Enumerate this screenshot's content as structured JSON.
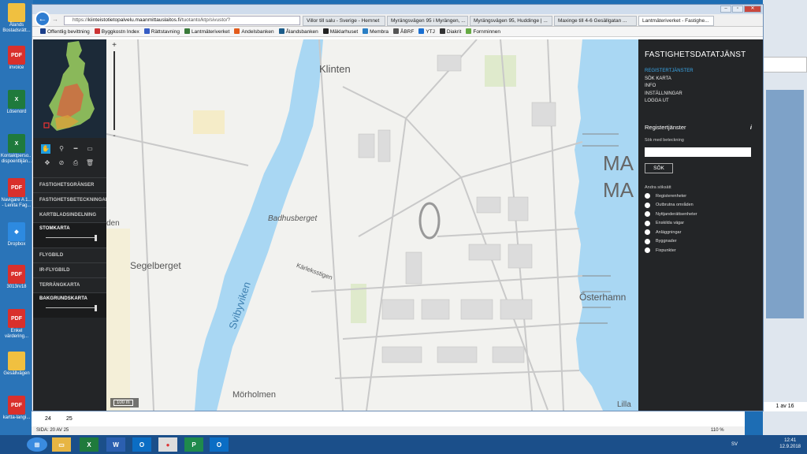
{
  "desktop": {
    "icons": [
      {
        "label": "Ålands Bostadsrätt...",
        "color": "#f0c040"
      },
      {
        "label": "invoice",
        "color": "#d9302c",
        "badge": "PDF"
      },
      {
        "label": "Lösenord",
        "color": "#1f7a3c",
        "badge": "X"
      },
      {
        "label": "Kontaktperso... dispoentlijän...",
        "color": "#1f7a3c",
        "badge": "X"
      },
      {
        "label": "Navigare A 1... - Lenita Fag...",
        "color": "#d9302c",
        "badge": "PDF"
      },
      {
        "label": "Dropbox",
        "color": "#2d8ae0",
        "badge": "◆"
      },
      {
        "label": "3013rv18",
        "color": "#d9302c",
        "badge": "PDF"
      },
      {
        "label": "Enkel värdering...",
        "color": "#d9302c",
        "badge": "PDF"
      },
      {
        "label": "Gesällvägen",
        "color": "#f0c040"
      },
      {
        "label": "kartta-langi...",
        "color": "#d9302c",
        "badge": "PDF"
      }
    ]
  },
  "browser": {
    "url_prefix": "https://",
    "url_host": "kiinteistotietopalvelu.maanmittauslaitos.fi",
    "url_path": "/tuotanto/ktp/sivusto/?",
    "tabs": [
      {
        "label": "Villor till salu - Sverige - Hemnet"
      },
      {
        "label": "Myrängsvägen 95 i Myrängen, ..."
      },
      {
        "label": "Myrängsvägen 95, Huddinge | ..."
      },
      {
        "label": "Maxinge till 4-6 Gesällgatan ..."
      },
      {
        "label": "Lantmäteriverket - Fastighe...",
        "active": true
      }
    ],
    "favorites": [
      {
        "label": "Offentlig bevittning",
        "color": "#1b3f8a"
      },
      {
        "label": "Byggkostn Index",
        "color": "#c33"
      },
      {
        "label": "Rättstavning",
        "color": "#355cc4"
      },
      {
        "label": "Lantmäteriverket",
        "color": "#3a7a3a"
      },
      {
        "label": "Andelsbanken",
        "color": "#e35b1b"
      },
      {
        "label": "Ålandsbanken",
        "color": "#1b5c8a"
      },
      {
        "label": "Mäklarhuset",
        "color": "#222"
      },
      {
        "label": "Membra",
        "color": "#2a7fc4"
      },
      {
        "label": "ÅBRF",
        "color": "#555"
      },
      {
        "label": "YTJ",
        "color": "#1a6fd1"
      },
      {
        "label": "Diakrit",
        "color": "#333"
      },
      {
        "label": "Fornminnen",
        "color": "#6a4"
      }
    ]
  },
  "left_panel": {
    "layers": [
      {
        "label": "FASTIGHETSGRÄNSER"
      },
      {
        "label": "FASTIGHETSBETECKNINGAR"
      },
      {
        "label": "KARTBLADSINDELNING"
      },
      {
        "label": "STOMKARTA",
        "selected": true,
        "opacity": 1.0
      },
      {
        "label": "FLYGBILD"
      },
      {
        "label": "IR-FLYGBILD"
      },
      {
        "label": "TERRÄNGKARTA"
      },
      {
        "label": "BAKGRUNDSKARTA",
        "selected": true,
        "opacity": 1.0
      }
    ]
  },
  "map": {
    "zoom_in": "+",
    "zoom_out": "-",
    "scale_label": "100 m",
    "labels": {
      "klinten": "Klinten",
      "badhusberget": "Badhusberget",
      "segelberget": "Segelberget",
      "karleksstigen": "Kärleksstigen",
      "svibyviken": "Svibyviken",
      "mörholmen": "Mörholmen",
      "osterhamn": "Österhamn",
      "den": "den",
      "lilla": "Lilla",
      "ma1": "MA",
      "ma2": "MA"
    }
  },
  "right_panel": {
    "title": "FASTIGHETSDATATJÄNST",
    "menu": [
      "REGISTERTJÄNSTER",
      "SÖK KARTA",
      "INFO",
      "INSTÄLLNINGAR",
      "LOGGA UT"
    ],
    "section_title": "Registertjänster",
    "info_icon": "i",
    "search_label": "Sök med beteckning",
    "search_value": "",
    "search_button": "SÖK",
    "other_label": "Andra söksätt",
    "options": [
      "Registerenheter",
      "Outbrutna områden",
      "Nyttjanderättsenheter",
      "Enskilda vägar",
      "Anläggningar",
      "Byggnader",
      "Fixpunkter"
    ]
  },
  "pdf_viewer": {
    "page_numbers": [
      "24",
      "25"
    ],
    "status": "SIDA: 20 AV 25",
    "zoom": "110 %",
    "page_of": "1 av 16"
  },
  "taskbar": {
    "lang": "SV",
    "time": "12:41",
    "date": "12.9.2018"
  }
}
